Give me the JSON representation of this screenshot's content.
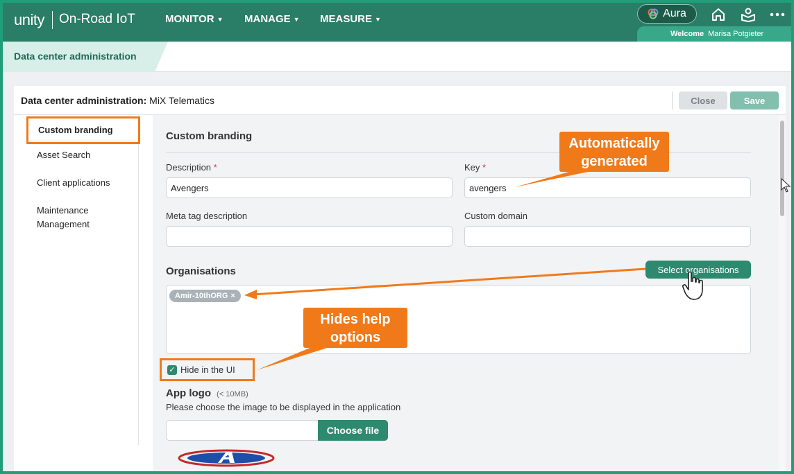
{
  "topbar": {
    "logo_text": "unity",
    "product": "On-Road IoT",
    "nav": [
      "MONITOR",
      "MANAGE",
      "MEASURE"
    ],
    "aura_label": "Aura",
    "welcome_label": "Welcome",
    "user_name": "Marisa Potgieter"
  },
  "breadcrumb": {
    "title": "Data center administration"
  },
  "panel": {
    "title_label": "Data center administration:",
    "title_value": "MiX Telematics",
    "close_label": "Close",
    "save_label": "Save"
  },
  "sidebar": {
    "items": [
      {
        "label": "Custom branding",
        "active": true
      },
      {
        "label": "Asset Search"
      },
      {
        "label": "Client applications"
      },
      {
        "label": "Maintenance"
      },
      {
        "label": "Management"
      }
    ]
  },
  "form": {
    "section_title": "Custom branding",
    "description_label": "Description",
    "description_value": "Avengers",
    "key_label": "Key",
    "key_value": "avengers",
    "required_mark": "*",
    "meta_label": "Meta tag description",
    "meta_value": "",
    "domain_label": "Custom domain",
    "domain_value": "",
    "organisations_label": "Organisations",
    "select_orgs_label": "Select organisations",
    "org_chip": "Amir-10thORG",
    "chip_remove": "×",
    "hide_label": "Hide in the UI",
    "hide_checked_mark": "✓",
    "app_logo_label": "App logo",
    "app_logo_limit": "(< 10MB)",
    "app_logo_hint": "Please choose the image to be displayed in the application",
    "choose_file_label": "Choose file"
  },
  "annotations": {
    "auto_line1": "Automatically",
    "auto_line2": "generated",
    "hides_line1": "Hides help",
    "hides_line2": "options"
  },
  "colors": {
    "brand": "#2a7d66",
    "accent": "#2e8a6f",
    "callout": "#f07a1a"
  }
}
